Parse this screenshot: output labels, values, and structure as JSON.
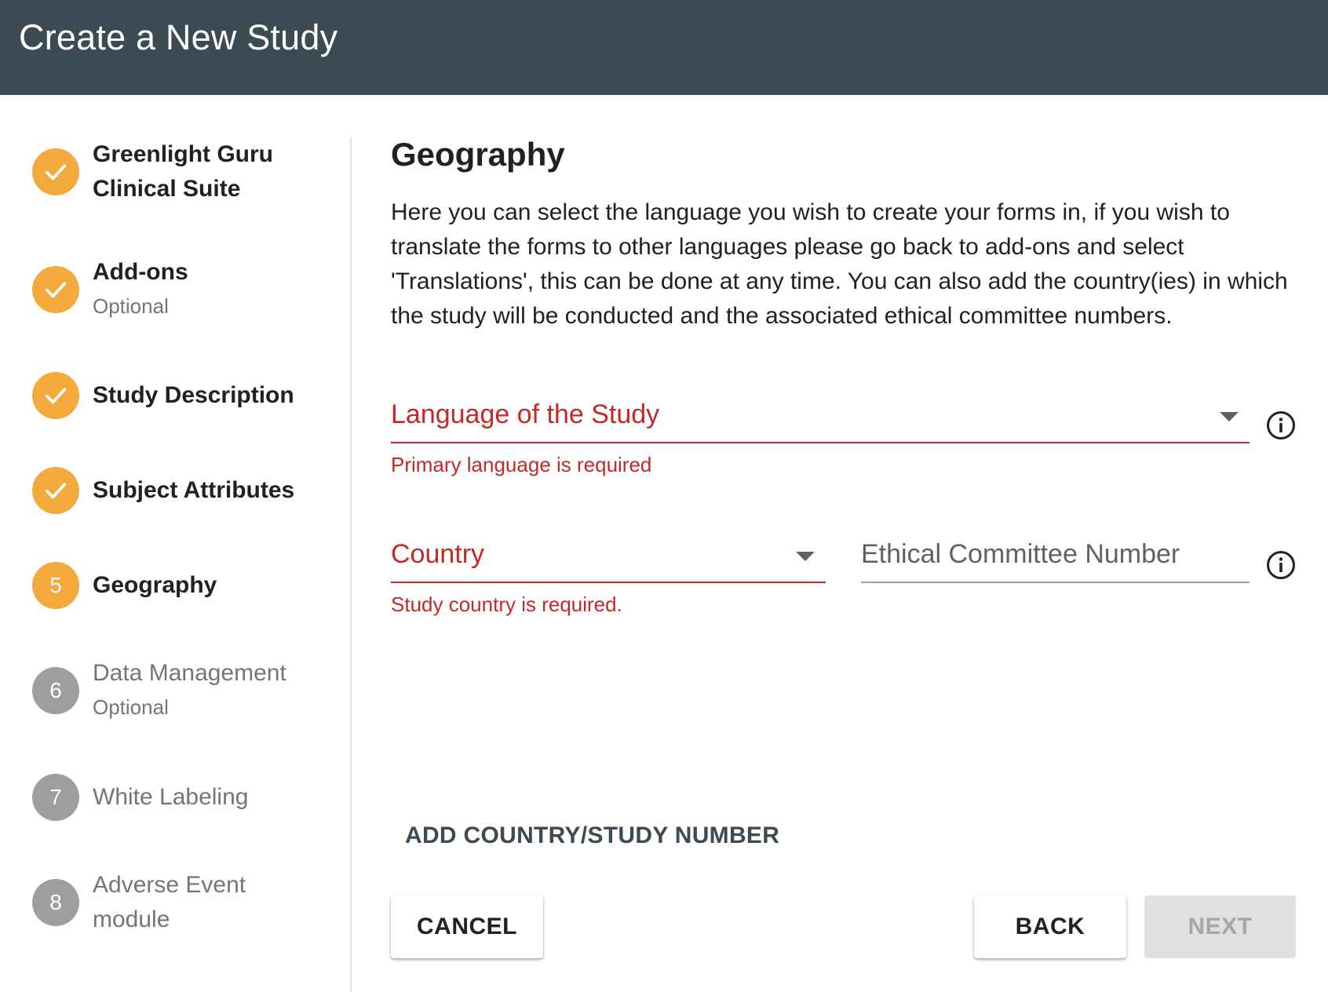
{
  "header": {
    "title": "Create a New Study"
  },
  "sidebar": {
    "steps": [
      {
        "label_line1": "Greenlight Guru",
        "label_line2": "Clinical Suite",
        "state": "done"
      },
      {
        "label": "Add-ons",
        "sub": "Optional",
        "state": "done"
      },
      {
        "label": "Study Description",
        "state": "done"
      },
      {
        "label": "Subject Attributes",
        "state": "done"
      },
      {
        "number": "5",
        "label": "Geography",
        "state": "active"
      },
      {
        "number": "6",
        "label": "Data Management",
        "sub": "Optional",
        "state": "todo"
      },
      {
        "number": "7",
        "label": "White Labeling",
        "state": "todo"
      },
      {
        "number": "8",
        "label_line1": "Adverse Event",
        "label_line2": "module",
        "state": "todo"
      }
    ]
  },
  "main": {
    "title": "Geography",
    "description": "Here you can select the language you wish to create your forms in, if you wish to translate the forms to other languages please go back to add-ons and select 'Translations', this can be done at any time. You can also add the country(ies) in which the study will be conducted and the associated ethical committee numbers.",
    "language_field": {
      "label": "Language of the Study",
      "error": "Primary language is required"
    },
    "country_field": {
      "label": "Country",
      "error": "Study country is required."
    },
    "ethics_field": {
      "label": "Ethical Committee Number"
    },
    "add_link": "ADD COUNTRY/STUDY NUMBER"
  },
  "buttons": {
    "cancel": "CANCEL",
    "back": "BACK",
    "next": "NEXT"
  },
  "colors": {
    "header": "#3c4a53",
    "accent": "#f4a93d",
    "error": "#c62828",
    "inactive": "#9e9e9e"
  }
}
